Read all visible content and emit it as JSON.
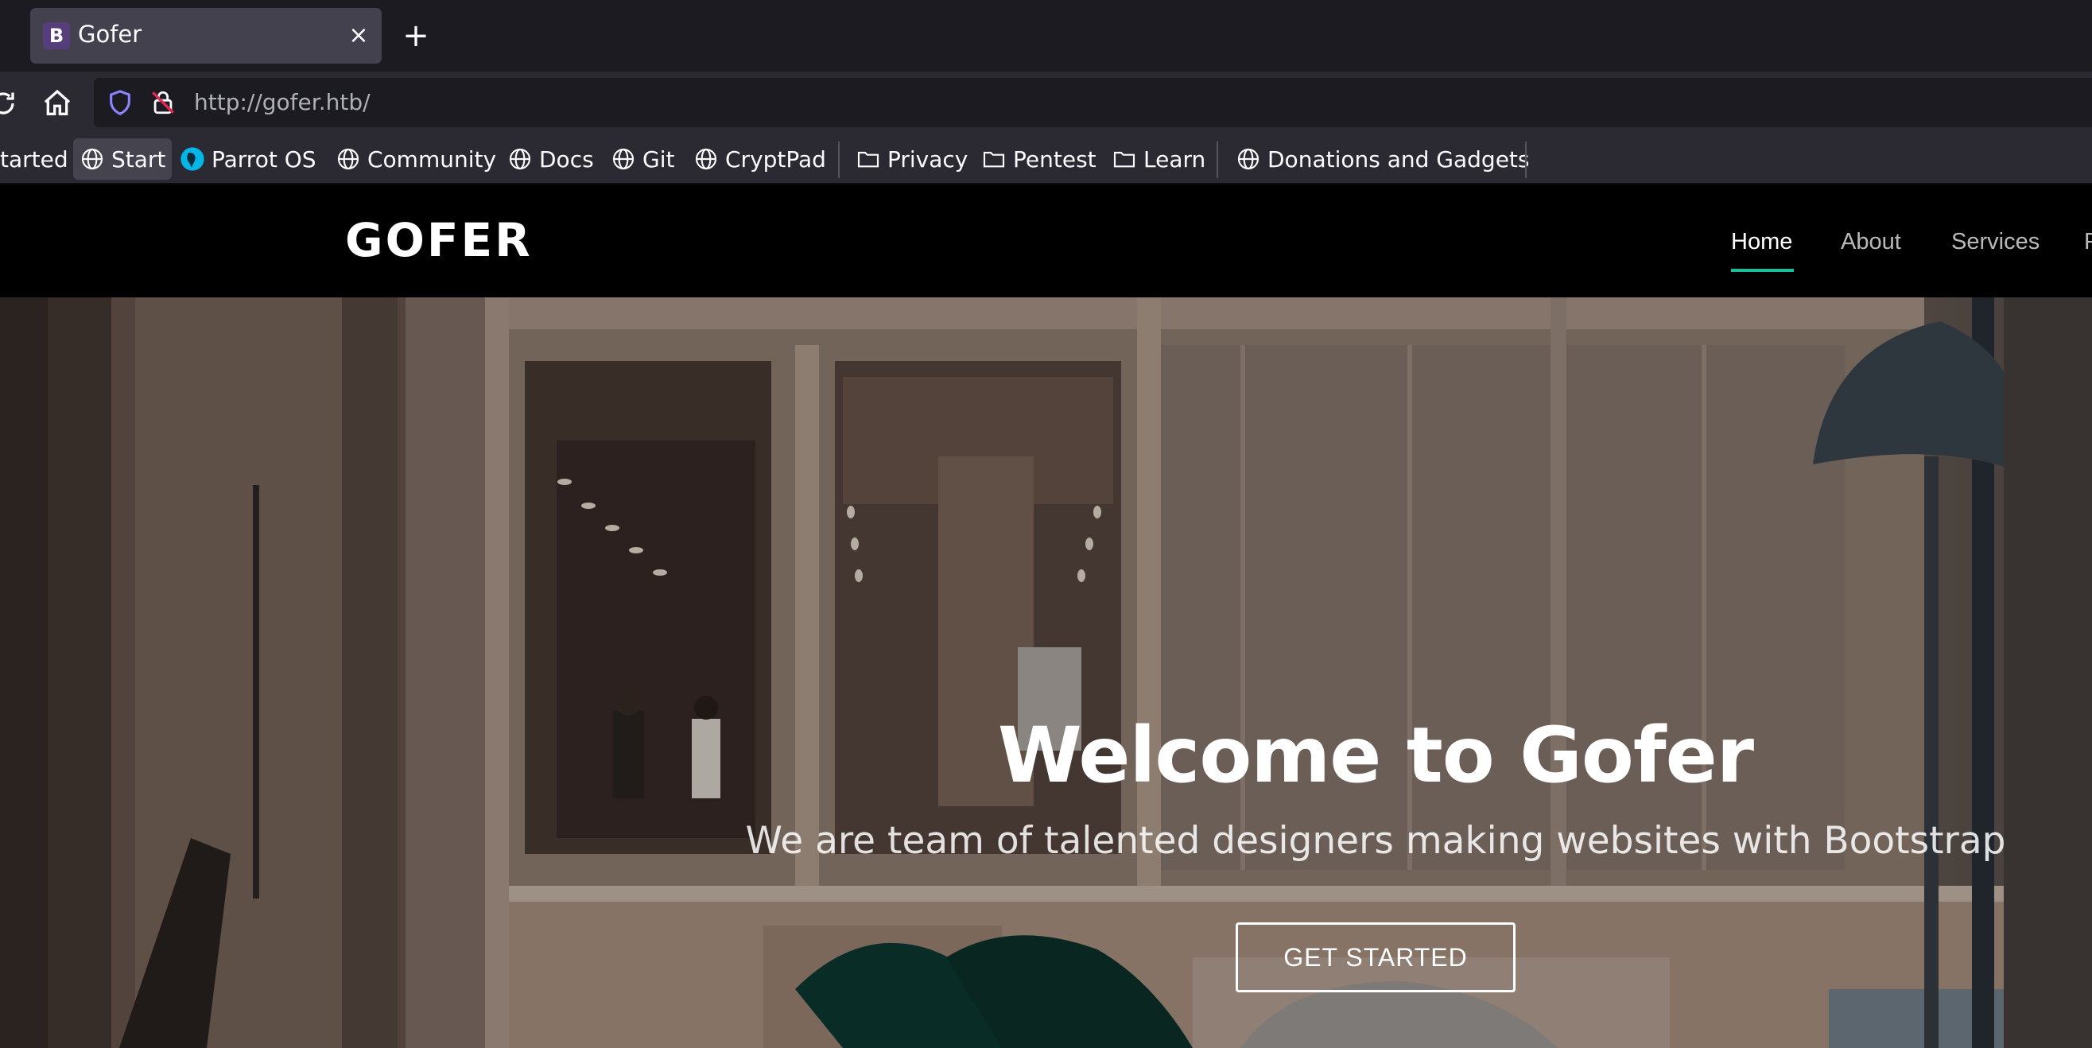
{
  "browser": {
    "tab": {
      "favicon_letter": "B",
      "title": "Gofer",
      "close_glyph": "×"
    },
    "new_tab_glyph": "+",
    "url": "http://gofer.htb/",
    "icons": [
      "reload-icon",
      "home-icon",
      "shield-icon",
      "insecure-lock-icon"
    ],
    "bookmarks": [
      {
        "label": "tarted",
        "icon": "none"
      },
      {
        "label": "Start",
        "icon": "globe-icon"
      },
      {
        "label": "Parrot OS",
        "icon": "parrot-icon"
      },
      {
        "label": "Community",
        "icon": "globe-icon"
      },
      {
        "label": "Docs",
        "icon": "globe-icon"
      },
      {
        "label": "Git",
        "icon": "globe-icon"
      },
      {
        "label": "CryptPad",
        "icon": "globe-icon"
      },
      {
        "label": "Privacy",
        "icon": "folder-icon"
      },
      {
        "label": "Pentest",
        "icon": "folder-icon"
      },
      {
        "label": "Learn",
        "icon": "folder-icon"
      },
      {
        "label": "Donations and Gadgets",
        "icon": "globe-icon"
      }
    ]
  },
  "site": {
    "logo": "GOFER",
    "nav": [
      {
        "label": "Home",
        "active": true
      },
      {
        "label": "About",
        "active": false
      },
      {
        "label": "Services",
        "active": false
      },
      {
        "label": "P",
        "active": false
      }
    ],
    "accent_color": "#1bbd9b",
    "hero": {
      "title": "Welcome to Gofer",
      "subtitle": "We are team of talented designers making websites with Bootstrap",
      "cta": "GET STARTED"
    }
  }
}
